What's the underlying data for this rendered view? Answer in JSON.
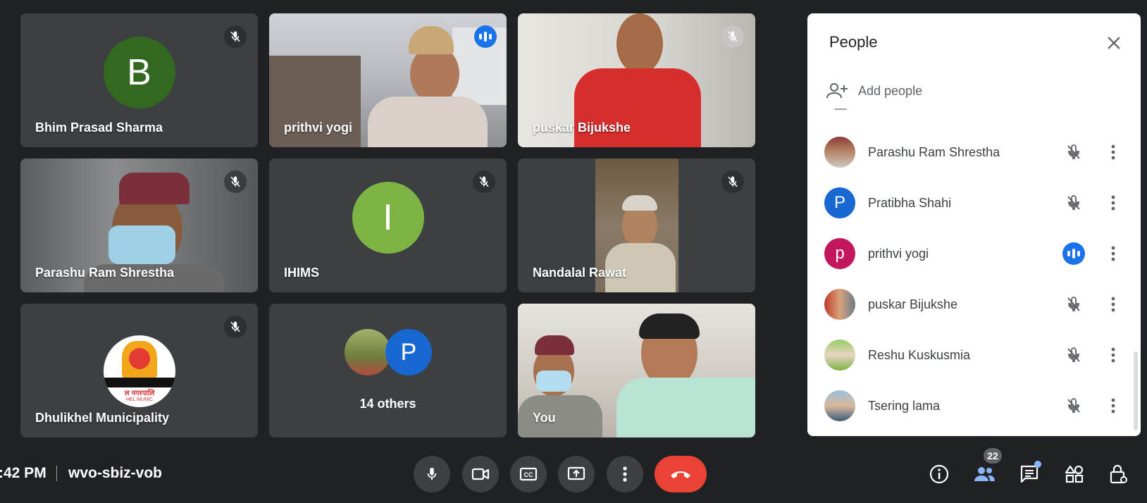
{
  "tiles": [
    {
      "name": "Bhim Prasad Sharma",
      "initial": "B",
      "avatar_color": "#33691e"
    },
    {
      "name": "prithvi yogi"
    },
    {
      "name": "puskar Bijukshe"
    },
    {
      "name": "Parashu Ram Shrestha"
    },
    {
      "name": "IHIMS",
      "initial": "I",
      "avatar_color": "#7cb342"
    },
    {
      "name": "Nandalal Rawat"
    },
    {
      "name": "Dhulikhel Municipality",
      "logo_text": "ल नगरपालि",
      "logo_subtext": "HEL MUNIC"
    },
    {
      "others_label": "14 others",
      "initial": "P",
      "avatar_color": "#1967d2"
    },
    {
      "name": "You"
    }
  ],
  "panel": {
    "title": "People",
    "add_people": "Add people",
    "participants": [
      {
        "name": "Parashu Ram Shrestha",
        "status": "muted"
      },
      {
        "name": "Pratibha Shahi",
        "initial": "P",
        "avatar_color": "#1967d2",
        "status": "muted"
      },
      {
        "name": "prithvi yogi",
        "initial": "p",
        "avatar_color": "#c2185b",
        "status": "speaking"
      },
      {
        "name": "puskar Bijukshe",
        "status": "muted"
      },
      {
        "name": "Reshu Kuskusmia",
        "status": "muted"
      },
      {
        "name": "Tsering lama",
        "status": "muted"
      }
    ]
  },
  "bottom": {
    "time": ":42 PM",
    "meeting_code": "wvo-sbiz-vob",
    "people_count": "22"
  },
  "colors": {
    "background": "#202124",
    "tile": "#3c4043",
    "accent_blue": "#1a73e8",
    "end_call_red": "#ea4335"
  }
}
